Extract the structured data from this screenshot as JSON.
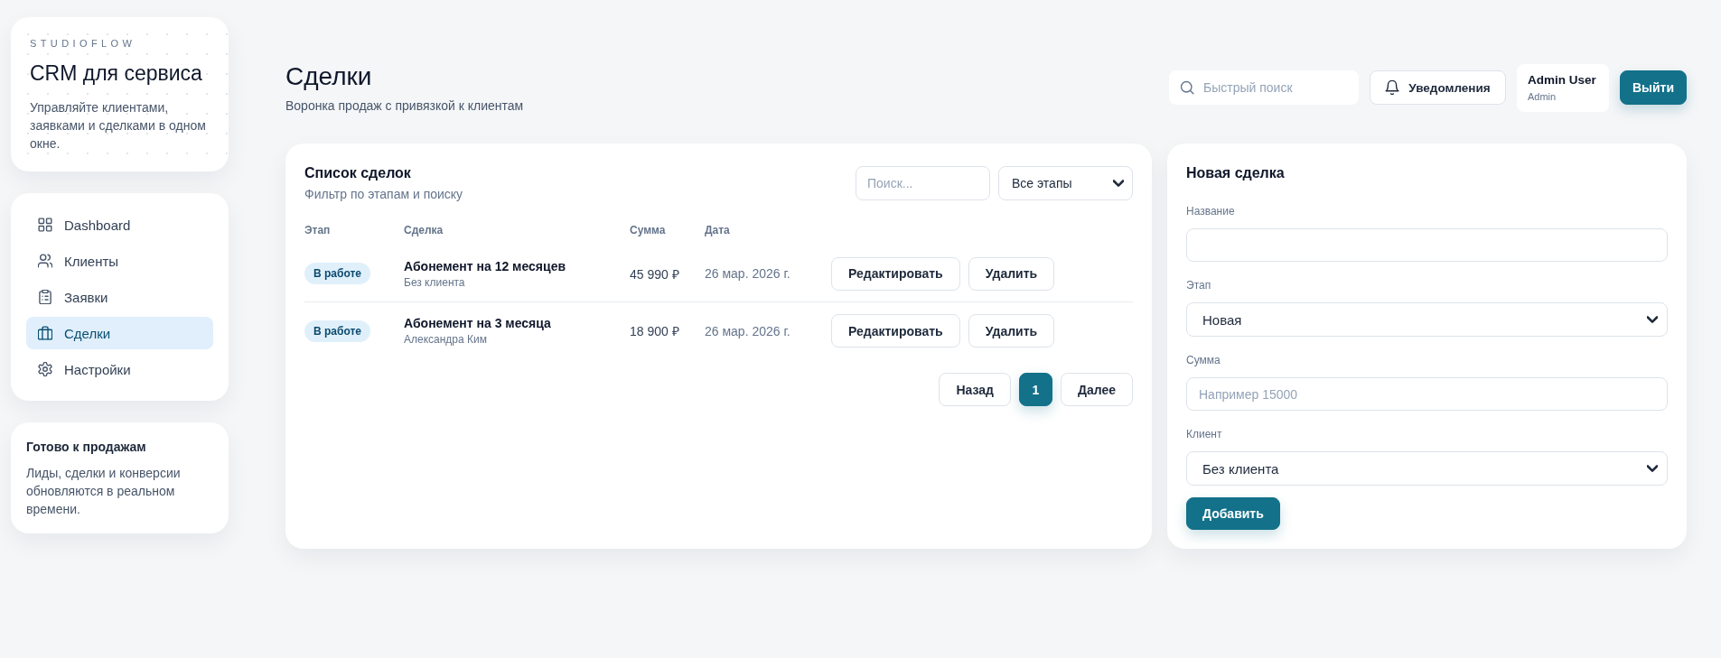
{
  "sidebar": {
    "brand": {
      "eyebrow": "STUDIOFLOW",
      "title": "CRM для сервиса",
      "text": "Управляйте клиентами, заявками и сделками в одном окне."
    },
    "nav": [
      {
        "label": "Dashboard",
        "selected": false
      },
      {
        "label": "Клиенты",
        "selected": false
      },
      {
        "label": "Заявки",
        "selected": false
      },
      {
        "label": "Сделки",
        "selected": true
      },
      {
        "label": "Настройки",
        "selected": false
      }
    ],
    "info": {
      "title": "Готово к продажам",
      "text": "Лиды, сделки и конверсии обновляются в реальном времени."
    }
  },
  "header": {
    "title": "Сделки",
    "subtitle": "Воронка продаж с привязкой к клиентам",
    "search": {
      "placeholder": "Быстрый поиск"
    },
    "notifications_button": "Уведомления",
    "user": {
      "name": "Admin User",
      "role": "Admin"
    },
    "logout_button": "Выйти"
  },
  "deals": {
    "title": "Список сделок",
    "subtitle": "Фильтр по этапам и поиску",
    "search": {
      "placeholder": "Поиск..."
    },
    "stage_filter": {
      "value": "Все этапы"
    },
    "columns": [
      "Этап",
      "Сделка",
      "Сумма",
      "Дата"
    ],
    "rows": [
      {
        "stage": "В работе",
        "name": "Абонемент на 12 месяцев",
        "client": "Без клиента",
        "amount": "45 990 ₽",
        "date": "26 мар. 2026 г.",
        "actions": [
          "Редактировать",
          "Удалить"
        ]
      },
      {
        "stage": "В работе",
        "name": "Абонемент на 3 месяца",
        "client": "Александра Ким",
        "amount": "18 900 ₽",
        "date": "26 мар. 2026 г.",
        "actions": [
          "Редактировать",
          "Удалить"
        ]
      }
    ],
    "pagination": {
      "prev": "Назад",
      "pages": [
        {
          "label": "1",
          "selected": true
        }
      ],
      "next": "Далее"
    }
  },
  "new_deal": {
    "title": "Новая сделка",
    "fields": [
      {
        "kind": "input",
        "label": "Название"
      },
      {
        "kind": "select",
        "label": "Этап",
        "value": "Новая"
      },
      {
        "kind": "input",
        "label": "Сумма",
        "placeholder": "Например 15000"
      },
      {
        "kind": "select",
        "label": "Клиент",
        "value": "Без клиента"
      }
    ],
    "submit": "Добавить"
  }
}
